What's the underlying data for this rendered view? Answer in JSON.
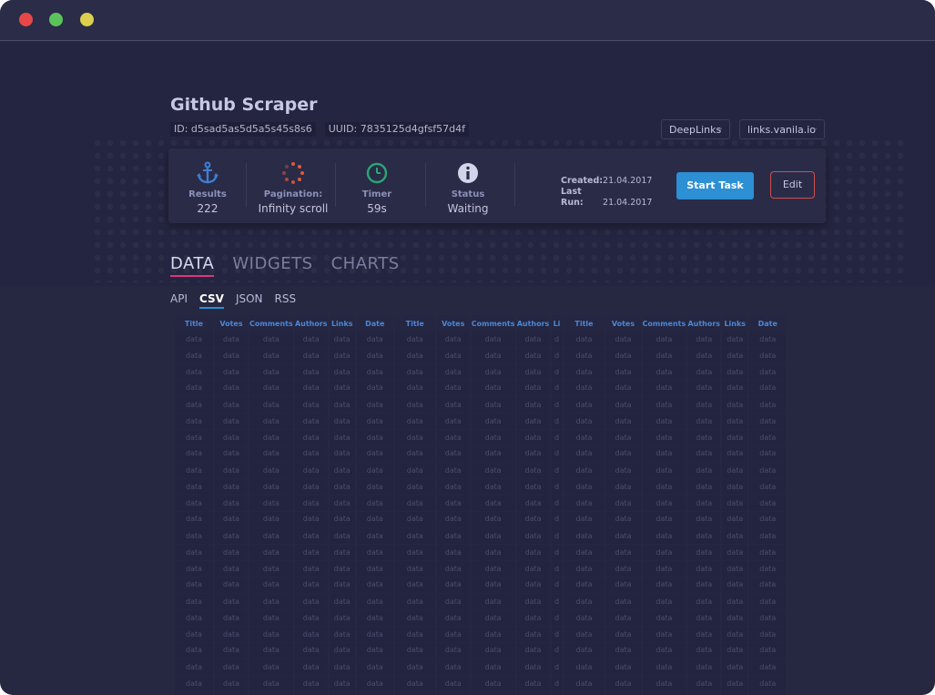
{
  "window": {
    "buttons": [
      "close",
      "minimize",
      "maximize"
    ]
  },
  "header": {
    "title": "Github Scraper",
    "id_label": "ID: d5sad5as5d5a5s45s8s6",
    "uuid_label": "UUID: 7835125d4gfsf57d4f",
    "dropdown1": "DeepLinks",
    "dropdown2": "links.vanila.io"
  },
  "stats": {
    "results": {
      "label": "Results",
      "value": "222",
      "icon": "anchor-icon"
    },
    "pagination": {
      "label": "Pagination:",
      "value": "Infinity scroll",
      "icon": "spinner-icon"
    },
    "timer": {
      "label": "Timer",
      "value": "59s",
      "icon": "clock-icon"
    },
    "status": {
      "label": "Status",
      "value": "Waiting",
      "icon": "info-icon"
    }
  },
  "meta": {
    "created_label": "Created:",
    "created_value": "21.04.2017",
    "lastrun_label": "Last Run:",
    "lastrun_value": "21.04.2017"
  },
  "actions": {
    "start": "Start Task",
    "edit": "Edit"
  },
  "tabs": [
    "DATA",
    "WIDGETS",
    "CHARTS"
  ],
  "subtabs": [
    "API",
    "CSV",
    "JSON",
    "RSS"
  ],
  "table": {
    "headers": [
      "Title",
      "Votes",
      "Comments",
      "Authors",
      "Links",
      "Date",
      "Title",
      "Votes",
      "Comments",
      "Authors",
      "Li",
      "Title",
      "Votes",
      "Comments",
      "Authors",
      "Links",
      "Date"
    ],
    "cell": "data",
    "truncated_cell": "d",
    "rows": 23
  },
  "colors": {
    "accent_blue": "#2d8fd4",
    "tab_underline": "#e0357a",
    "edit_border": "#d0504d",
    "anchor_icon": "#3f7fd4",
    "spinner_icon": "#e05a3a",
    "clock_icon": "#2aa676"
  }
}
